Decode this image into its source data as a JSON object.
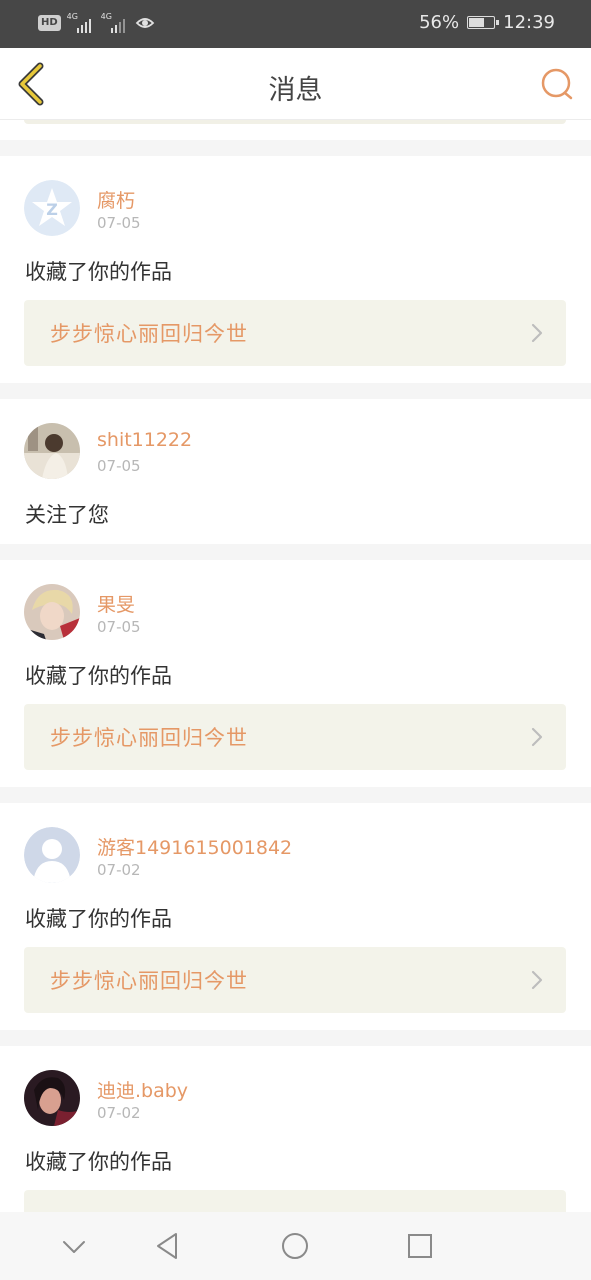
{
  "status_bar": {
    "hd": "HD",
    "net1": "4G",
    "net2": "4G",
    "battery": "56%",
    "battery_level": 0.56,
    "time": "12:39"
  },
  "header": {
    "title": "消息"
  },
  "messages": [
    {
      "username": "腐朽",
      "date": "07-05",
      "action": "收藏了你的作品",
      "work_title": "步步惊心丽回归今世",
      "avatar": "qq-default-avatar"
    },
    {
      "username": "shit11222",
      "date": "07-05",
      "action": "关注了您",
      "work_title": "",
      "avatar": "user-photo-avatar"
    },
    {
      "username": "果旻",
      "date": "07-05",
      "action": "收藏了你的作品",
      "work_title": "步步惊心丽回归今世",
      "avatar": "user-photo-avatar"
    },
    {
      "username": "游客1491615001842",
      "date": "07-02",
      "action": "收藏了你的作品",
      "work_title": "步步惊心丽回归今世",
      "avatar": "guest-default-avatar"
    },
    {
      "username": "迪迪.baby",
      "date": "07-02",
      "action": "收藏了你的作品",
      "work_title": "",
      "avatar": "user-photo-avatar"
    }
  ],
  "colors": {
    "accent": "#e59866",
    "back_icon": "#e8c93a",
    "card_link_bg": "#f3f3ea"
  },
  "icons": {
    "back": "chevron-left-icon",
    "search": "search-icon",
    "link_arrow": "chevron-right-icon",
    "sys_down": "chevron-down-icon",
    "sys_back": "triangle-back-icon",
    "sys_home": "circle-home-icon",
    "sys_recents": "square-recents-icon"
  }
}
